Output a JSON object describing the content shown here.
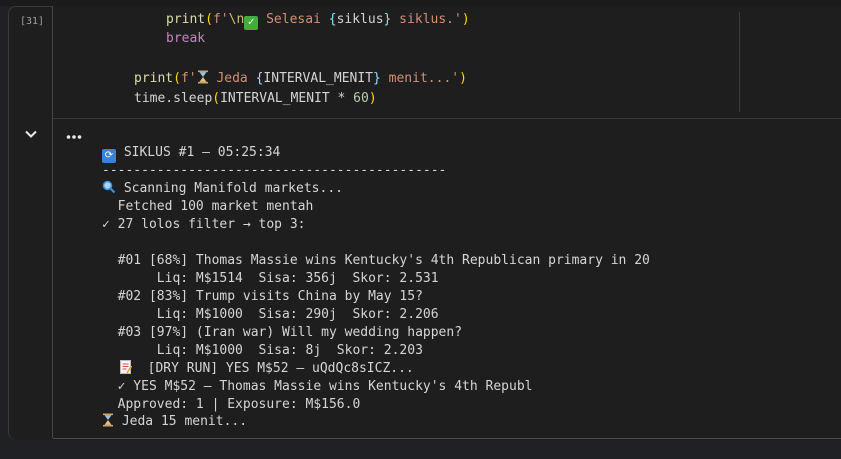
{
  "cell": {
    "exec_count": "[31]"
  },
  "code": {
    "line1_fn": "print",
    "line1_p1": "(",
    "line1_s1": "f'",
    "line1_esc": "\\n",
    "line1_s2": " Selesai ",
    "line1_b1": "{",
    "line1_var": "siklus",
    "line1_b2": "}",
    "line1_s3": " siklus.'",
    "line1_p2": ")",
    "line2_kw": "break",
    "line3_fn": "print",
    "line3_p1": "(",
    "line3_s1": "f'",
    "line3_s2": " Jeda ",
    "line3_b1": "{",
    "line3_var": "INTERVAL_MENIT",
    "line3_b2": "}",
    "line3_s3": " menit...'",
    "line3_p2": ")",
    "line4_obj": "time.sleep",
    "line4_p1": "(",
    "line4_var": "INTERVAL_MENIT * ",
    "line4_num": "60",
    "line4_p2": ")"
  },
  "output": {
    "cycle_header": " SIKLUS #1 — 05:25:34",
    "separator": "--------------------------------------------",
    "scanning": " Scanning Manifold markets...",
    "fetched": "  Fetched 100 market mentah",
    "filter": "✓ 27 lolos filter → top 3:",
    "m1_title": "  #01 [68%] Thomas Massie wins Kentucky's 4th Republican primary in 20",
    "m1_stats": "       Liq: M$1514  Sisa: 356j  Skor: 2.531",
    "m2_title": "  #02 [83%] Trump visits China by May 15?",
    "m2_stats": "       Liq: M$1000  Sisa: 290j  Skor: 2.206",
    "m3_title": "  #03 [97%] (Iran war) Will my wedding happen?",
    "m3_stats": "       Liq: M$1000  Sisa: 8j  Skor: 2.203",
    "dry_run": "  [DRY RUN] YES M$52 — uQdQc8sICZ...",
    "yes_line": "  ✓ YES M$52 — Thomas Massie wins Kentucky's 4th Republ",
    "approved": "  Approved: 1 | Exposure: M$156.0",
    "jeda": " Jeda 15 menit..."
  },
  "icons": {
    "run": "stop-run-icon",
    "collapse": "chevron-down-icon",
    "menu": "more-horiz-icon",
    "check": "check-mark-icon",
    "cycle": "cycle-arrows-icon",
    "hourglass": "hourglass-icon",
    "search": "magnifier-icon",
    "memo": "memo-icon"
  },
  "colors": {
    "background": "#1e1e1e",
    "keyword": "#c586c0",
    "function": "#dcdcaa",
    "string": "#ce9178",
    "number": "#b5cea8",
    "bracket_outer": "#ffd700",
    "bracket_inner": "#da70d6",
    "variable": "#9cdcfe"
  }
}
